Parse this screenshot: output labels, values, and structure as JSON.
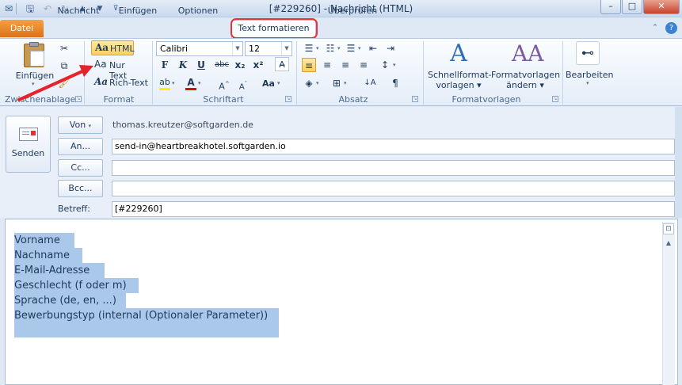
{
  "window": {
    "title": "[#229260] - Nachricht (HTML)",
    "minimize_label": "–",
    "maximize_label": "□",
    "close_label": "✕"
  },
  "tabs": [
    "Datei",
    "Nachricht",
    "Einfügen",
    "Optionen",
    "Text formatieren",
    "Überprüfen"
  ],
  "ribbon": {
    "clipboard": {
      "paste_label": "Einfügen",
      "group_label": "Zwischenablage"
    },
    "format": {
      "html_label": "HTML",
      "plain_label": "Nur Text",
      "rich_label": "Rich-Text",
      "group_label": "Format"
    },
    "font": {
      "family": "Calibri",
      "size": "12",
      "bold": "F",
      "italic": "K",
      "underline": "U",
      "strike": "abc",
      "subscript": "x₂",
      "superscript": "x²",
      "group_label": "Schriftart"
    },
    "paragraph": {
      "group_label": "Absatz"
    },
    "styles": {
      "quick_label_1": "Schnellformat-",
      "quick_label_2": "vorlagen ▾",
      "change_label_1": "Formatvorlagen",
      "change_label_2": "ändern ▾",
      "group_label": "Formatvorlagen"
    },
    "editing": {
      "edit_label": "Bearbeiten"
    }
  },
  "message": {
    "send_label": "Senden",
    "from_button": "Von",
    "from_value": "thomas.kreutzer@softgarden.de",
    "to_button": "An...",
    "to_value": "send-in@heartbreakhotel.softgarden.io",
    "cc_button": "Cc...",
    "cc_value": "",
    "bcc_button": "Bcc...",
    "bcc_value": "",
    "subject_label": "Betreff:",
    "subject_value": "[#229260]"
  },
  "body_lines": [
    "Vorname",
    "Nachname",
    "E-Mail-Adresse",
    "Geschlecht (f oder m)",
    "Sprache (de, en, ...)",
    "Bewerbungstyp (internal (Optionaler Parameter))"
  ],
  "colors": {
    "accent_file_tab": "#e07115",
    "highlight_box": "#e0353a",
    "annotation_arrow": "#e8222a",
    "selection": "#a9c8ea"
  }
}
